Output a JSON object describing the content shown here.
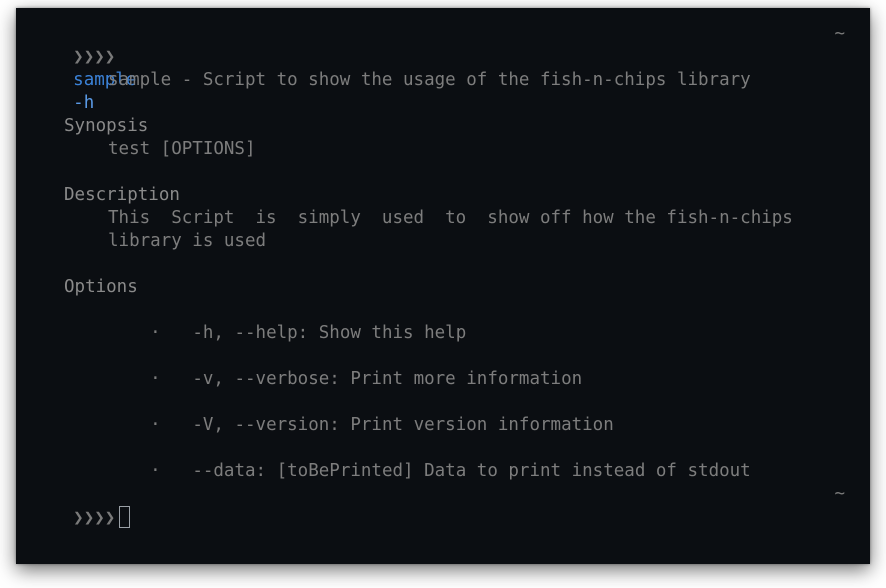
{
  "terminal": {
    "prompt_symbol": "❯❯❯❯",
    "command": "sample",
    "command_args": "-h",
    "cwd": "~",
    "help": {
      "title_line": "sample - Script to show the usage of the fish-n-chips library",
      "synopsis_heading": "Synopsis",
      "synopsis_text": "test [OPTIONS]",
      "description_heading": "Description",
      "description_line1": "This  Script  is  simply  used  to  show off how the fish-n-chips",
      "description_line2": "library is used",
      "options_heading": "Options",
      "bullet": "·",
      "options": [
        "-h, --help: Show this help",
        "-v, --verbose: Print more information",
        "-V, --version: Print version information",
        "--data: [toBePrinted] Data to print instead of stdout"
      ]
    },
    "second_prompt_cwd": "~"
  }
}
